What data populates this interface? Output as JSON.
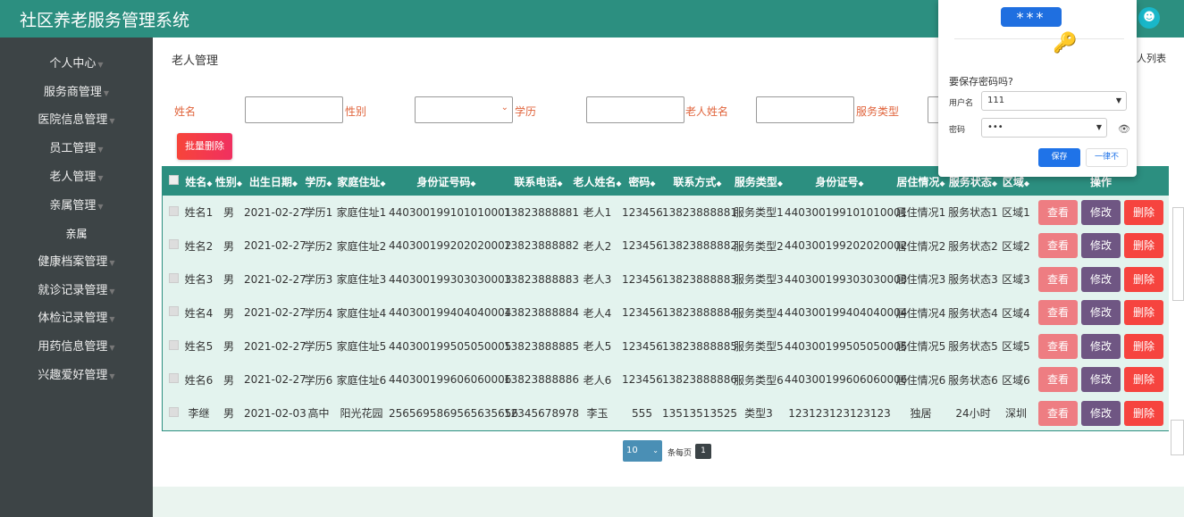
{
  "app_title": "社区养老服务管理系统",
  "sidebar": {
    "items": [
      {
        "label": "个人中心"
      },
      {
        "label": "服务商管理"
      },
      {
        "label": "医院信息管理"
      },
      {
        "label": "员工管理"
      },
      {
        "label": "老人管理"
      },
      {
        "label": "亲属管理"
      },
      {
        "label": "亲属",
        "sub": true
      },
      {
        "label": "健康档案管理"
      },
      {
        "label": "就诊记录管理"
      },
      {
        "label": "体检记录管理"
      },
      {
        "label": "用药信息管理"
      },
      {
        "label": "兴趣爱好管理"
      }
    ]
  },
  "breadcrumb": "老人管理",
  "breadcrumb_right": "人列表",
  "filters": {
    "name": "姓名",
    "gender": "性别",
    "education": "学历",
    "elder_name": "老人姓名",
    "service_type": "服务类型"
  },
  "batch_delete": "批量删除",
  "table": {
    "headers": [
      "姓名",
      "性别",
      "出生日期",
      "学历",
      "家庭住址",
      "身份证号码",
      "联系电话",
      "老人姓名",
      "密码",
      "联系方式",
      "服务类型",
      "身份证号",
      "居住情况",
      "服务状态",
      "区域",
      "操作"
    ],
    "rows": [
      [
        "姓名1",
        "男",
        "2021-02-27",
        "学历1",
        "家庭住址1",
        "440300199101010001",
        "13823888881",
        "老人1",
        "123456",
        "13823888881",
        "服务类型1",
        "440300199101010001",
        "居住情况1",
        "服务状态1",
        "区域1"
      ],
      [
        "姓名2",
        "男",
        "2021-02-27",
        "学历2",
        "家庭住址2",
        "440300199202020002",
        "13823888882",
        "老人2",
        "123456",
        "13823888882",
        "服务类型2",
        "440300199202020002",
        "居住情况2",
        "服务状态2",
        "区域2"
      ],
      [
        "姓名3",
        "男",
        "2021-02-27",
        "学历3",
        "家庭住址3",
        "440300199303030003",
        "13823888883",
        "老人3",
        "123456",
        "13823888883",
        "服务类型3",
        "440300199303030003",
        "居住情况3",
        "服务状态3",
        "区域3"
      ],
      [
        "姓名4",
        "男",
        "2021-02-27",
        "学历4",
        "家庭住址4",
        "440300199404040004",
        "13823888884",
        "老人4",
        "123456",
        "13823888884",
        "服务类型4",
        "440300199404040004",
        "居住情况4",
        "服务状态4",
        "区域4"
      ],
      [
        "姓名5",
        "男",
        "2021-02-27",
        "学历5",
        "家庭住址5",
        "440300199505050005",
        "13823888885",
        "老人5",
        "123456",
        "13823888885",
        "服务类型5",
        "440300199505050005",
        "居住情况5",
        "服务状态5",
        "区域5"
      ],
      [
        "姓名6",
        "男",
        "2021-02-27",
        "学历6",
        "家庭住址6",
        "440300199606060006",
        "13823888886",
        "老人6",
        "123456",
        "13823888886",
        "服务类型6",
        "440300199606060006",
        "居住情况6",
        "服务状态6",
        "区域6"
      ],
      [
        "李继",
        "男",
        "2021-02-03",
        "高中",
        "阳光花园",
        "2565695869565635656",
        "12345678978",
        "李玉",
        "555",
        "13513513525",
        "类型3",
        "123123123123123",
        "独居",
        "24小时",
        "深圳"
      ]
    ],
    "actions": {
      "view": "查看",
      "edit": "修改",
      "delete": "删除"
    }
  },
  "pagination": {
    "page_size": "10",
    "per_page_label": "条每页",
    "current_page": "1"
  },
  "password_popup": {
    "illustration": "***",
    "question": "要保存密码吗?",
    "username_label": "用户名",
    "username": "111",
    "password_label": "密码",
    "password": "•••",
    "save": "保存",
    "never": "一律不"
  }
}
